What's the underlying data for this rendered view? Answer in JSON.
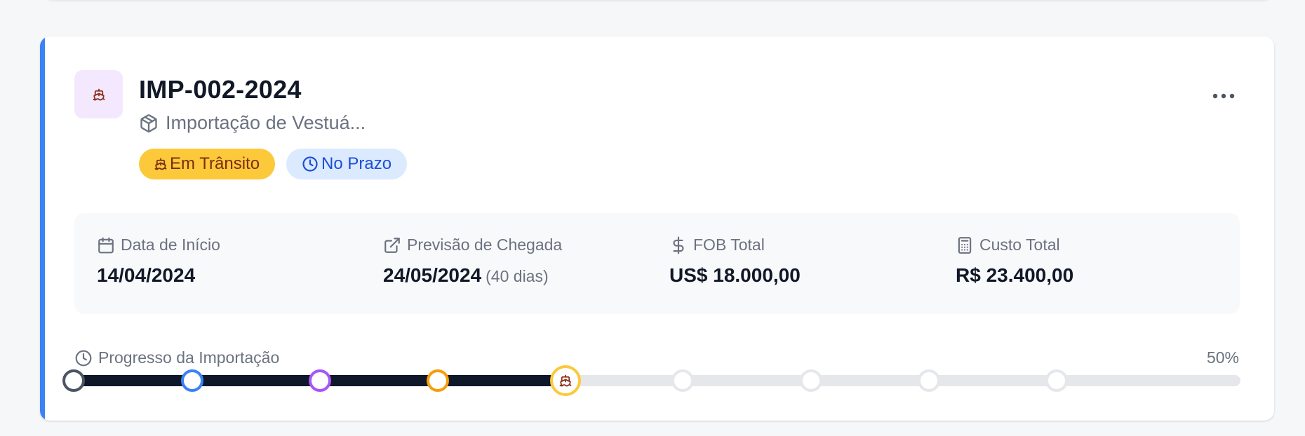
{
  "import": {
    "code": "IMP-002-2024",
    "description": "Importação de Vestuá..."
  },
  "badges": {
    "status": "Em Trânsito",
    "timing": "No Prazo"
  },
  "info": {
    "start": {
      "label": "Data de Início",
      "value": "14/04/2024"
    },
    "arrival": {
      "label": "Previsão de Chegada",
      "value": "24/05/2024",
      "note": "(40 dias)"
    },
    "fob": {
      "label": "FOB Total",
      "value": "US$ 18.000,00"
    },
    "cost": {
      "label": "Custo Total",
      "value": "R$ 23.400,00"
    }
  },
  "progress": {
    "label": "Progresso da Importação",
    "percent_label": "50%",
    "percent": 50,
    "current_stage": 4,
    "stages": [
      {
        "color": "#4b5563",
        "done": true
      },
      {
        "color": "#3b82f6",
        "done": true
      },
      {
        "color": "#a855f7",
        "done": true
      },
      {
        "color": "#f59e0b",
        "done": true
      },
      {
        "color": "#fcc93b",
        "done": true,
        "current": true
      },
      {
        "color": "#e5e7eb",
        "done": false
      },
      {
        "color": "#e5e7eb",
        "done": false
      },
      {
        "color": "#e5e7eb",
        "done": false
      },
      {
        "color": "#e5e7eb",
        "done": false
      }
    ]
  },
  "icons": {
    "header": "ship-icon",
    "description": "package-icon",
    "menu": "more-horizontal-icon",
    "status": "ship-icon",
    "timing": "clock-icon",
    "start": "calendar-icon",
    "arrival": "external-link-icon",
    "fob": "dollar-icon",
    "cost": "calculator-icon",
    "progress": "clock-icon"
  },
  "colors": {
    "accent": "#3b82f6",
    "transit_badge": "#fcc93b",
    "timing_badge": "#dbeafe",
    "progress_fill": "#0f172a"
  }
}
